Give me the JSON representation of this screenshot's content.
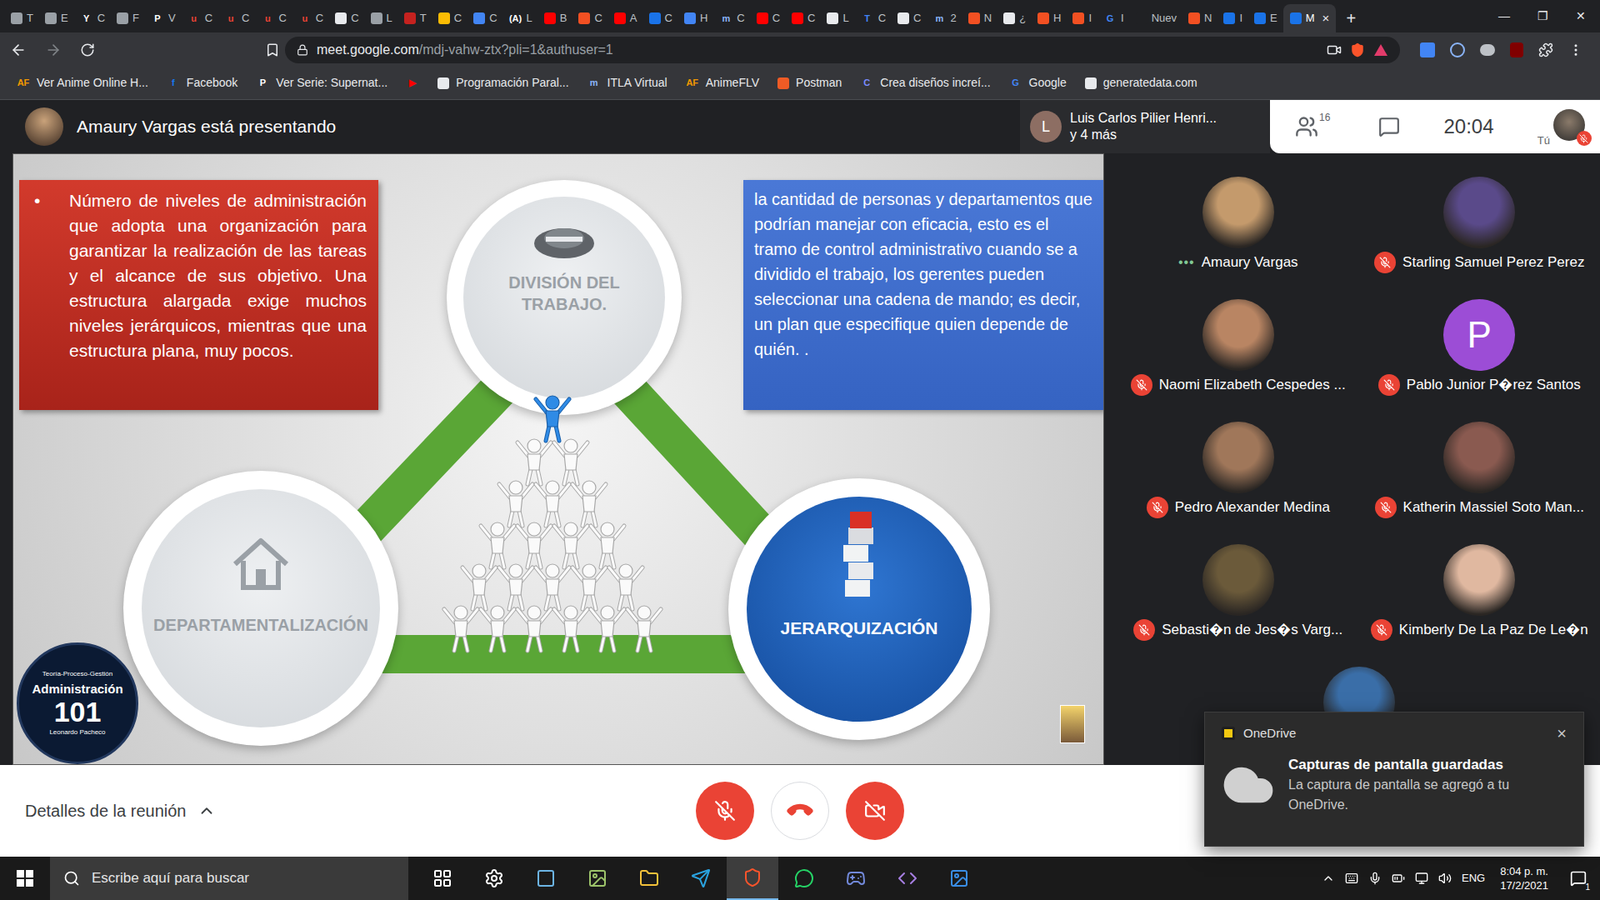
{
  "browser": {
    "tabs": [
      {
        "label": "T",
        "icon_text": "",
        "color": "#9aa0a6",
        "selected": false
      },
      {
        "label": "E",
        "icon_text": "",
        "color": "#9aa0a6",
        "selected": false
      },
      {
        "label": "C",
        "icon_text": "Y",
        "color": "#ffffff",
        "selected": false
      },
      {
        "label": "F",
        "icon_text": "",
        "color": "#9aa0a6",
        "selected": false
      },
      {
        "label": "V",
        "icon_text": "P",
        "color": "#ffffff",
        "selected": false
      },
      {
        "label": "C",
        "icon_text": "u",
        "color": "#ea4335",
        "selected": false
      },
      {
        "label": "C",
        "icon_text": "u",
        "color": "#ea4335",
        "selected": false
      },
      {
        "label": "C",
        "icon_text": "u",
        "color": "#ea4335",
        "selected": false
      },
      {
        "label": "C",
        "icon_text": "u",
        "color": "#ea4335",
        "selected": false
      },
      {
        "label": "C",
        "icon_text": "",
        "color": "#e8eaed",
        "selected": false
      },
      {
        "label": "L",
        "icon_text": "",
        "color": "#9aa0a6",
        "selected": false
      },
      {
        "label": "T",
        "icon_text": "",
        "color": "#c5221f",
        "selected": false
      },
      {
        "label": "C",
        "icon_text": "",
        "color": "#fbbc04",
        "selected": false
      },
      {
        "label": "C",
        "icon_text": "",
        "color": "#4285f4",
        "selected": false
      },
      {
        "label": "L",
        "icon_text": "(A)",
        "color": "#ffffff",
        "selected": false
      },
      {
        "label": "B",
        "icon_text": "",
        "color": "#ff0000",
        "selected": false
      },
      {
        "label": "C",
        "icon_text": "",
        "color": "#f25022",
        "selected": false
      },
      {
        "label": "A",
        "icon_text": "",
        "color": "#ff0000",
        "selected": false
      },
      {
        "label": "C",
        "icon_text": "",
        "color": "#1a73e8",
        "selected": false
      },
      {
        "label": "H",
        "icon_text": "",
        "color": "#4285f4",
        "selected": false
      },
      {
        "label": "C",
        "icon_text": "m",
        "color": "#8ab4f8",
        "selected": false
      },
      {
        "label": "C",
        "icon_text": "",
        "color": "#ff0000",
        "selected": false
      },
      {
        "label": "C",
        "icon_text": "",
        "color": "#ff0000",
        "selected": false
      },
      {
        "label": "L",
        "icon_text": "",
        "color": "#e8eaed",
        "selected": false
      },
      {
        "label": "C",
        "icon_text": "T",
        "color": "#4285f4",
        "selected": false
      },
      {
        "label": "C",
        "icon_text": "",
        "color": "#e8eaed",
        "selected": false
      },
      {
        "label": "2",
        "icon_text": "m",
        "color": "#8ab4f8",
        "selected": false
      },
      {
        "label": "N",
        "icon_text": "",
        "color": "#f25022",
        "selected": false
      },
      {
        "label": "¿",
        "icon_text": "",
        "color": "#e8eaed",
        "selected": false
      },
      {
        "label": "H",
        "icon_text": "",
        "color": "#f25022",
        "selected": false
      },
      {
        "label": "I",
        "icon_text": "",
        "color": "#f25022",
        "selected": false
      },
      {
        "label": "I",
        "icon_text": "G",
        "color": "#4285f4",
        "selected": false
      },
      {
        "label": "Nuev",
        "icon_text": "",
        "color": "#202124",
        "selected": false
      },
      {
        "label": "N",
        "icon_text": "",
        "color": "#f25022",
        "selected": false
      },
      {
        "label": "I",
        "icon_text": "",
        "color": "#1a73e8",
        "selected": false
      },
      {
        "label": "E",
        "icon_text": "",
        "color": "#1a73e8",
        "selected": false
      },
      {
        "label": "M",
        "icon_text": "",
        "color": "#1a73e8",
        "selected": true
      }
    ],
    "tab_close": "×",
    "new_tab": "+",
    "window_controls": [
      "—",
      "❐",
      "✕"
    ],
    "url_host": "meet.google.com",
    "url_path": "/mdj-vahw-ztx?pli=1&authuser=1",
    "bookmarks": [
      {
        "label": "Ver Anime Online H...",
        "icon_text": "AF",
        "color": "#f29900"
      },
      {
        "label": "Facebook",
        "icon_text": "f",
        "color": "#1877f2"
      },
      {
        "label": "Ver Serie: Supernat...",
        "icon_text": "P",
        "color": "#ffffff"
      },
      {
        "label": "",
        "icon_text": "▶",
        "color": "#ff0000"
      },
      {
        "label": "Programación Paral...",
        "icon_text": "",
        "color": "#e8eaed"
      },
      {
        "label": "ITLA Virtual",
        "icon_text": "m",
        "color": "#8ab4f8"
      },
      {
        "label": "AnimeFLV",
        "icon_text": "AF",
        "color": "#f29900"
      },
      {
        "label": "Postman",
        "icon_text": "",
        "color": "#ef5b25"
      },
      {
        "label": "Crea diseños increí...",
        "icon_text": "C",
        "color": "#7b8cff"
      },
      {
        "label": "Google",
        "icon_text": "G",
        "color": "#4285f4"
      },
      {
        "label": "generatedata.com",
        "icon_text": "",
        "color": "#e8eaed"
      }
    ]
  },
  "meeting": {
    "presenter_banner": "Amaury Vargas está presentando",
    "others_initial": "L",
    "others_name": "Luis Carlos Pilier Henri...",
    "others_more": "y 4 más",
    "participant_count": "16",
    "clock": "20:04",
    "self_label": "Tú",
    "self_muted": true,
    "participants": [
      {
        "name": "Amaury Vargas",
        "muted": false,
        "indicator": "•••",
        "kind": "photo",
        "color": "#c49a6c"
      },
      {
        "name": "Starling Samuel Perez Perez",
        "muted": true,
        "indicator": "",
        "kind": "photo",
        "color": "#5a4a8a"
      },
      {
        "name": "Naomi Elizabeth Cespedes ...",
        "muted": true,
        "indicator": "",
        "kind": "photo",
        "color": "#b98563"
      },
      {
        "name": "Pablo Junior P�rez Santos",
        "muted": true,
        "indicator": "",
        "kind": "initial",
        "initial": "P",
        "color": "#9c4dd6"
      },
      {
        "name": "Pedro Alexander Medina",
        "muted": true,
        "indicator": "",
        "kind": "photo",
        "color": "#a0775a"
      },
      {
        "name": "Katherin Massiel Soto Man...",
        "muted": true,
        "indicator": "",
        "kind": "photo",
        "color": "#8a5a50"
      },
      {
        "name": "Sebasti�n de Jes�s Varg...",
        "muted": true,
        "indicator": "",
        "kind": "photo",
        "color": "#6b5a3a"
      },
      {
        "name": "Kimberly De La Paz De Le�n",
        "muted": true,
        "indicator": "",
        "kind": "photo",
        "color": "#e0b8a0"
      },
      {
        "kind": "photo",
        "muted": false,
        "indicator": "",
        "color": "#3a6ea8"
      }
    ],
    "details": "Detalles de la reunión",
    "mic_on": false,
    "camera_on": false
  },
  "slide": {
    "bullet": "•",
    "left_box": "Número de niveles de administración que adopta una organización para garantizar la realización de las tareas y el alcance de sus objetivo. Una estructura alargada exige muchos niveles jerárquicos, mientras que una estructura plana, muy pocos.",
    "right_box": "la cantidad de personas y departamentos que podrían manejar con eficacia, esto es el tramo de control administrativo cuando se a dividido el trabajo, los gerentes pueden seleccionar una cadena de mando; es decir, un plan que especifique quien depende de quién. .",
    "nodes": [
      {
        "label": "DIVISIÓN DEL TRABAJO.",
        "kind": "light"
      },
      {
        "label": "DEPARTAMENTALIZACIÓN",
        "kind": "light"
      },
      {
        "label": "JERARQUIZACIÓN",
        "kind": "dark"
      }
    ],
    "logo": {
      "top": "Teoría-Proceso-Gestión",
      "title": "Administración",
      "number": "101",
      "bottom": "Leonardo Pacheco"
    }
  },
  "toast": {
    "app": "OneDrive",
    "title": "Capturas de pantalla guardadas",
    "body": "La captura de pantalla se agregó a tu OneDrive.",
    "close": "×"
  },
  "taskbar": {
    "search": "Escribe aquí para buscar",
    "apps": [
      {
        "kind": "taskview",
        "active": false,
        "color": "#ffffff"
      },
      {
        "kind": "gear",
        "active": false,
        "color": "#ffffff"
      },
      {
        "kind": "app",
        "active": false,
        "color": "#6cb4e4"
      },
      {
        "kind": "photos",
        "active": false,
        "color": "#9cc36a"
      },
      {
        "kind": "folder",
        "active": false,
        "color": "#f3c13a"
      },
      {
        "kind": "telegram",
        "active": false,
        "color": "#2aa3e0"
      },
      {
        "kind": "brave",
        "active": true,
        "color": "#fb542b"
      },
      {
        "kind": "whatsapp",
        "active": false,
        "color": "#25d366"
      },
      {
        "kind": "discord",
        "active": false,
        "color": "#7289da"
      },
      {
        "kind": "vs",
        "active": false,
        "color": "#a57ee0"
      },
      {
        "kind": "photos",
        "active": false,
        "color": "#3a8ee6"
      }
    ],
    "language": "ENG",
    "time": "8:04 p. m.",
    "date": "17/2/2021",
    "notifications": "1"
  }
}
